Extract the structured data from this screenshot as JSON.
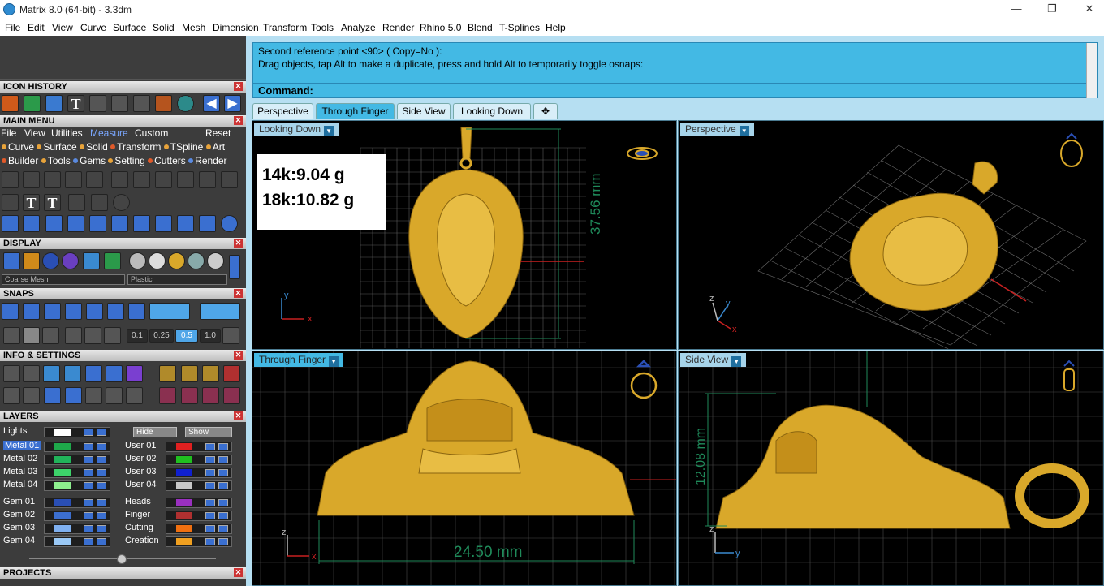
{
  "window": {
    "title": "Matrix 8.0 (64-bit) - 3.3dm",
    "controls": [
      "—",
      "❐",
      "✕"
    ]
  },
  "menu": [
    "File",
    "Edit",
    "View",
    "Curve",
    "Surface",
    "Solid",
    "Mesh",
    "Dimension",
    "Transform",
    "Tools",
    "Analyze",
    "Render",
    "Rhino 5.0",
    "Blend",
    "T-Splines",
    "Help"
  ],
  "panels": {
    "icon_history": "ICON HISTORY",
    "main_menu": "MAIN MENU",
    "display": "DISPLAY",
    "snaps": "SNAPS",
    "info_settings": "INFO & SETTINGS",
    "layers": "LAYERS",
    "projects": "PROJECTS",
    "close_glyph": "✕"
  },
  "main_menu": {
    "tabs": [
      "File",
      "View",
      "Utilities",
      "Measure",
      "Custom"
    ],
    "active_tab": "Measure",
    "reset": "Reset",
    "row1": [
      {
        "label": "Curve",
        "color": "#e8a33a"
      },
      {
        "label": "Surface",
        "color": "#e8a33a"
      },
      {
        "label": "Solid",
        "color": "#e8a33a"
      },
      {
        "label": "Transform",
        "color": "#e05a2a"
      },
      {
        "label": "TSpline",
        "color": "#e8a33a"
      },
      {
        "label": "Art",
        "color": "#e8a33a"
      }
    ],
    "row2": [
      {
        "label": "Builder",
        "color": "#e05a2a"
      },
      {
        "label": "Tools",
        "color": "#e8a33a"
      },
      {
        "label": "Gems",
        "color": "#5a8ae0"
      },
      {
        "label": "Setting",
        "color": "#e8a33a"
      },
      {
        "label": "Cutters",
        "color": "#e05a2a"
      },
      {
        "label": "Render",
        "color": "#5a8ae0"
      }
    ]
  },
  "display": {
    "mesh_select": "Coarse Mesh",
    "material_select": "Plastic"
  },
  "snaps": {
    "values": [
      "0.1",
      "0.25",
      "0.5",
      "1.0"
    ]
  },
  "layers": {
    "lights": "Lights",
    "hide": "Hide",
    "show": "Show",
    "left": [
      {
        "name": "Metal 01",
        "color": "#1ea84a",
        "selected": true
      },
      {
        "name": "Metal 02",
        "color": "#21b35a",
        "selected": false
      },
      {
        "name": "Metal 03",
        "color": "#3dd36a",
        "selected": false
      },
      {
        "name": "Metal 04",
        "color": "#8ef08e",
        "selected": false
      },
      {
        "name": "Gem 01",
        "color": "#2a4fb5",
        "selected": false
      },
      {
        "name": "Gem 02",
        "color": "#3c6fd0",
        "selected": false
      },
      {
        "name": "Gem 03",
        "color": "#7fb0f0",
        "selected": false
      },
      {
        "name": "Gem 04",
        "color": "#9ac8f5",
        "selected": false
      }
    ],
    "right": [
      {
        "name": "User 01",
        "color": "#e02020"
      },
      {
        "name": "User 02",
        "color": "#20c020"
      },
      {
        "name": "User 03",
        "color": "#1020d0"
      },
      {
        "name": "User 04",
        "color": "#c8c8c8"
      },
      {
        "name": "Heads",
        "color": "#9a30c0"
      },
      {
        "name": "Finger",
        "color": "#b03030"
      },
      {
        "name": "Cutting",
        "color": "#f07010"
      },
      {
        "name": "Creation",
        "color": "#f0a020"
      }
    ]
  },
  "command": {
    "line1": "Second reference point <90> ( Copy=No ):",
    "line2": "Drag objects, tap Alt to make a duplicate, press and hold Alt to temporarily toggle osnaps:",
    "prompt": "Command:"
  },
  "tabs": [
    "Perspective",
    "Through Finger",
    "Side View",
    "Looking Down",
    "✥"
  ],
  "active_tab": "Through Finger",
  "viewports": {
    "top_left": {
      "label": "Looking Down",
      "dim": "37.56 mm",
      "weight_14k": "14k:9.04 g",
      "weight_18k": "18k:10.82 g"
    },
    "top_right": {
      "label": "Perspective"
    },
    "bottom_left": {
      "label": "Through Finger",
      "dim": "24.50 mm"
    },
    "bottom_right": {
      "label": "Side View",
      "dim": "12.08 mm"
    }
  },
  "axis": {
    "x": "x",
    "y": "y",
    "z": "z"
  },
  "colors": {
    "gold": "#d9a82a",
    "cmd_blue": "#43b9e4",
    "viewport_bg": "#000000",
    "dim_green": "#1f8a5a"
  }
}
